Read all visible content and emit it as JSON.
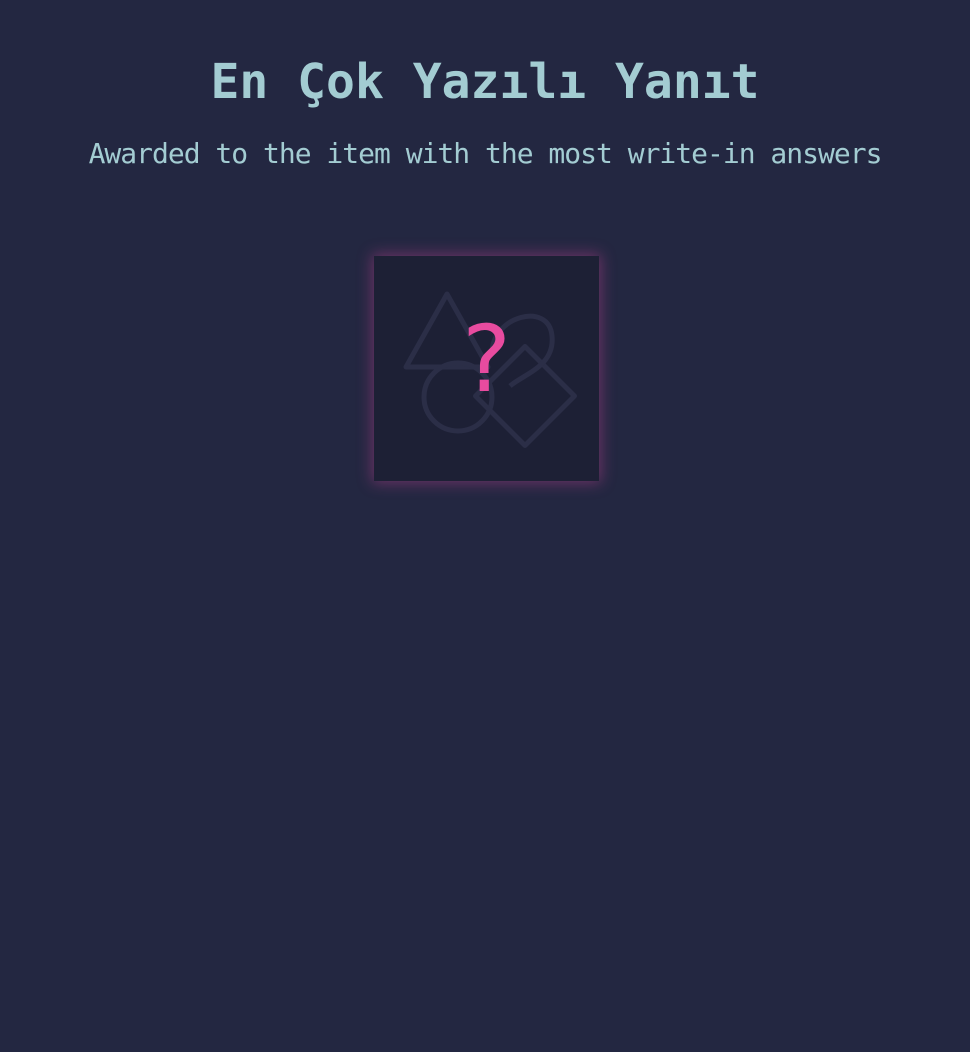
{
  "award": {
    "title": "En Çok Yazılı Yanıt",
    "subtitle": "Awarded to the item with the most write-in answers",
    "badge_symbol": "?",
    "badge_state": "locked",
    "badge_icon": "unknown-badge-icon"
  },
  "colors": {
    "background": "#232741",
    "text": "#a3ccd2",
    "accent": "#e84b9f",
    "card": "#1d2035",
    "shapes": "#2b2e47"
  }
}
